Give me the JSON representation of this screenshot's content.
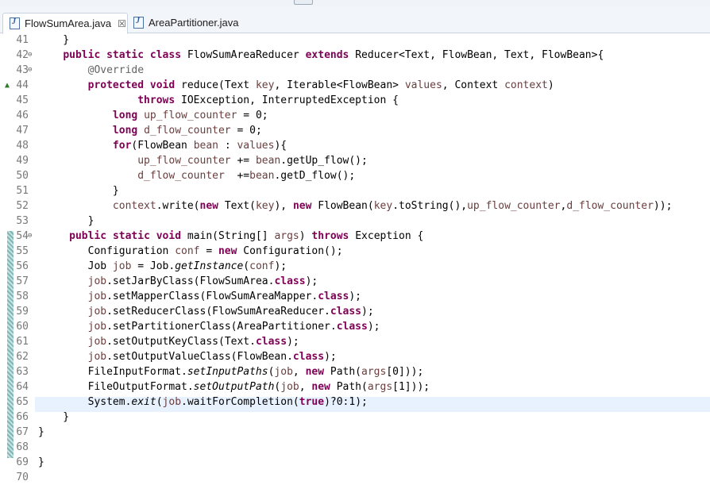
{
  "tabs": [
    {
      "label": "FlowSumArea.java",
      "close": "☒",
      "active": true
    },
    {
      "label": "AreaPartitioner.java",
      "active": false
    }
  ],
  "lines": [
    {
      "n": "41",
      "code": [
        [
          "t",
          "    }"
        ]
      ]
    },
    {
      "n": "42",
      "fold": "⊖",
      "code": [
        [
          "t",
          "    "
        ],
        [
          "kw",
          "public"
        ],
        [
          "t",
          " "
        ],
        [
          "kw",
          "static"
        ],
        [
          "t",
          " "
        ],
        [
          "kw",
          "class"
        ],
        [
          "t",
          " FlowSumAreaReducer "
        ],
        [
          "kw",
          "extends"
        ],
        [
          "t",
          " Reducer<Text, FlowBean, Text, FlowBean>{"
        ]
      ]
    },
    {
      "n": "43",
      "fold": "⊖",
      "code": [
        [
          "t",
          "        "
        ],
        [
          "ann",
          "@Override"
        ]
      ]
    },
    {
      "n": "44",
      "arrow": "▲",
      "code": [
        [
          "t",
          "        "
        ],
        [
          "kw",
          "protected"
        ],
        [
          "t",
          " "
        ],
        [
          "kw",
          "void"
        ],
        [
          "t",
          " reduce(Text "
        ],
        [
          "fd",
          "key"
        ],
        [
          "t",
          ", Iterable<FlowBean> "
        ],
        [
          "fd",
          "values"
        ],
        [
          "t",
          ", Context "
        ],
        [
          "fd",
          "context"
        ],
        [
          "t",
          ")"
        ]
      ]
    },
    {
      "n": "45",
      "code": [
        [
          "t",
          "                "
        ],
        [
          "kw",
          "throws"
        ],
        [
          "t",
          " IOException, InterruptedException {"
        ]
      ]
    },
    {
      "n": "46",
      "code": [
        [
          "t",
          "            "
        ],
        [
          "kw",
          "long"
        ],
        [
          "t",
          " "
        ],
        [
          "fd",
          "up_flow_counter"
        ],
        [
          "t",
          " = 0;"
        ]
      ]
    },
    {
      "n": "47",
      "code": [
        [
          "t",
          "            "
        ],
        [
          "kw",
          "long"
        ],
        [
          "t",
          " "
        ],
        [
          "fd",
          "d_flow_counter"
        ],
        [
          "t",
          " = 0;"
        ]
      ]
    },
    {
      "n": "48",
      "code": [
        [
          "t",
          "            "
        ],
        [
          "kw",
          "for"
        ],
        [
          "t",
          "(FlowBean "
        ],
        [
          "fd",
          "bean"
        ],
        [
          "t",
          " : "
        ],
        [
          "fd",
          "values"
        ],
        [
          "t",
          "){"
        ]
      ]
    },
    {
      "n": "49",
      "code": [
        [
          "t",
          "                "
        ],
        [
          "fd",
          "up_flow_counter"
        ],
        [
          "t",
          " += "
        ],
        [
          "fd",
          "bean"
        ],
        [
          "t",
          ".getUp_flow();"
        ]
      ]
    },
    {
      "n": "50",
      "code": [
        [
          "t",
          "                "
        ],
        [
          "fd",
          "d_flow_counter"
        ],
        [
          "t",
          "  +="
        ],
        [
          "fd",
          "bean"
        ],
        [
          "t",
          ".getD_flow();"
        ]
      ]
    },
    {
      "n": "51",
      "code": [
        [
          "t",
          "            }"
        ]
      ]
    },
    {
      "n": "52",
      "code": [
        [
          "t",
          "            "
        ],
        [
          "fd",
          "context"
        ],
        [
          "t",
          ".write("
        ],
        [
          "kw",
          "new"
        ],
        [
          "t",
          " Text("
        ],
        [
          "fd",
          "key"
        ],
        [
          "t",
          "), "
        ],
        [
          "kw",
          "new"
        ],
        [
          "t",
          " FlowBean("
        ],
        [
          "fd",
          "key"
        ],
        [
          "t",
          ".toString(),"
        ],
        [
          "fd",
          "up_flow_counter"
        ],
        [
          "t",
          ","
        ],
        [
          "fd",
          "d_flow_counter"
        ],
        [
          "t",
          "));"
        ]
      ]
    },
    {
      "n": "53",
      "code": [
        [
          "t",
          "        }"
        ]
      ]
    },
    {
      "n": "54",
      "fold": "⊖",
      "code": [
        [
          "t",
          "     "
        ],
        [
          "kw",
          "public"
        ],
        [
          "t",
          " "
        ],
        [
          "kw",
          "static"
        ],
        [
          "t",
          " "
        ],
        [
          "kw",
          "void"
        ],
        [
          "t",
          " main(String[] "
        ],
        [
          "fd",
          "args"
        ],
        [
          "t",
          ") "
        ],
        [
          "kw",
          "throws"
        ],
        [
          "t",
          " Exception {"
        ]
      ]
    },
    {
      "n": "55",
      "code": [
        [
          "t",
          "        Configuration "
        ],
        [
          "fd",
          "conf"
        ],
        [
          "t",
          " = "
        ],
        [
          "kw",
          "new"
        ],
        [
          "t",
          " Configuration();"
        ]
      ]
    },
    {
      "n": "56",
      "code": [
        [
          "t",
          "        Job "
        ],
        [
          "fd",
          "job"
        ],
        [
          "t",
          " = Job."
        ],
        [
          "it",
          "getInstance"
        ],
        [
          "t",
          "("
        ],
        [
          "fd",
          "conf"
        ],
        [
          "t",
          ");"
        ]
      ]
    },
    {
      "n": "57",
      "code": [
        [
          "t",
          "        "
        ],
        [
          "fd",
          "job"
        ],
        [
          "t",
          ".setJarByClass(FlowSumArea."
        ],
        [
          "kw",
          "class"
        ],
        [
          "t",
          ");"
        ]
      ]
    },
    {
      "n": "58",
      "code": [
        [
          "t",
          "        "
        ],
        [
          "fd",
          "job"
        ],
        [
          "t",
          ".setMapperClass(FlowSumAreaMapper."
        ],
        [
          "kw",
          "class"
        ],
        [
          "t",
          ");"
        ]
      ]
    },
    {
      "n": "59",
      "code": [
        [
          "t",
          "        "
        ],
        [
          "fd",
          "job"
        ],
        [
          "t",
          ".setReducerClass(FlowSumAreaReducer."
        ],
        [
          "kw",
          "class"
        ],
        [
          "t",
          ");"
        ]
      ]
    },
    {
      "n": "60",
      "code": [
        [
          "t",
          "        "
        ],
        [
          "fd",
          "job"
        ],
        [
          "t",
          ".setPartitionerClass(AreaPartitioner."
        ],
        [
          "kw",
          "class"
        ],
        [
          "t",
          ");"
        ]
      ]
    },
    {
      "n": "61",
      "code": [
        [
          "t",
          "        "
        ],
        [
          "fd",
          "job"
        ],
        [
          "t",
          ".setOutputKeyClass(Text."
        ],
        [
          "kw",
          "class"
        ],
        [
          "t",
          ");"
        ]
      ]
    },
    {
      "n": "62",
      "code": [
        [
          "t",
          "        "
        ],
        [
          "fd",
          "job"
        ],
        [
          "t",
          ".setOutputValueClass(FlowBean."
        ],
        [
          "kw",
          "class"
        ],
        [
          "t",
          ");"
        ]
      ]
    },
    {
      "n": "63",
      "code": [
        [
          "t",
          "        FileInputFormat."
        ],
        [
          "it",
          "setInputPaths"
        ],
        [
          "t",
          "("
        ],
        [
          "fd",
          "job"
        ],
        [
          "t",
          ", "
        ],
        [
          "kw",
          "new"
        ],
        [
          "t",
          " Path("
        ],
        [
          "fd",
          "args"
        ],
        [
          "t",
          "[0]));"
        ]
      ]
    },
    {
      "n": "64",
      "code": [
        [
          "t",
          "        FileOutputFormat."
        ],
        [
          "it",
          "setOutputPath"
        ],
        [
          "t",
          "("
        ],
        [
          "fd",
          "job"
        ],
        [
          "t",
          ", "
        ],
        [
          "kw",
          "new"
        ],
        [
          "t",
          " Path("
        ],
        [
          "fd",
          "args"
        ],
        [
          "t",
          "[1]));"
        ]
      ]
    },
    {
      "n": "65",
      "code": [
        [
          "t",
          "        System."
        ],
        [
          "it",
          "exit"
        ],
        [
          "t",
          "("
        ],
        [
          "fd",
          "job"
        ],
        [
          "t",
          ".waitForCompletion("
        ],
        [
          "kw",
          "true"
        ],
        [
          "t",
          ")?0:1);"
        ]
      ]
    },
    {
      "n": "66",
      "code": [
        [
          "t",
          "    }"
        ]
      ]
    },
    {
      "n": "67",
      "code": [
        [
          "t",
          "}"
        ]
      ]
    },
    {
      "n": "68",
      "code": []
    },
    {
      "n": "69",
      "code": [
        [
          "t",
          "}"
        ]
      ]
    },
    {
      "n": "70",
      "code": []
    }
  ]
}
